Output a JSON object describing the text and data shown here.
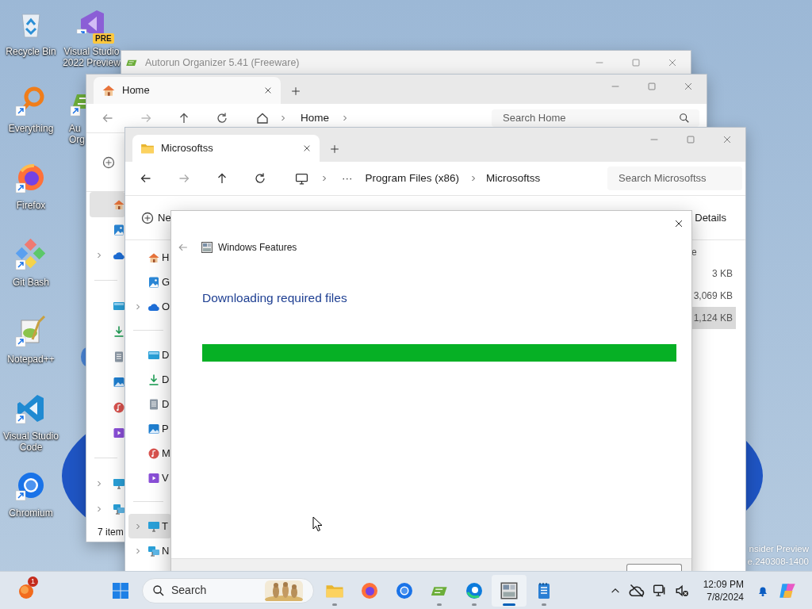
{
  "desktop": {
    "columns": [
      [
        {
          "label": "Recycle Bin",
          "shortcut": false
        },
        {
          "label": "Everything",
          "shortcut": true
        },
        {
          "label": "Firefox",
          "shortcut": true
        },
        {
          "label": "Git Bash",
          "shortcut": true
        },
        {
          "label": "Notepad++",
          "shortcut": true
        },
        {
          "label": "Visual Studio Code",
          "shortcut": true
        },
        {
          "label": "Chromium",
          "shortcut": true
        }
      ],
      [
        {
          "label": "Visual Studio 2022 Preview",
          "badge": "PRE",
          "shortcut": true
        },
        {
          "label": "Au Org",
          "shortcut": true
        }
      ]
    ]
  },
  "build_info": [
    "nsider Preview",
    "e.240308-1400"
  ],
  "autorun_window": {
    "title": "Autorun Organizer 5.41 (Freeware)"
  },
  "home_window": {
    "tab": "Home",
    "breadcrumb": "Home",
    "search": {
      "placeholder": "Search Home"
    },
    "nav_groups": [
      [
        {
          "selected": true,
          "expandable": false
        },
        {
          "selected": false,
          "expandable": false
        },
        {
          "selected": false,
          "expandable": true
        }
      ],
      [
        {
          "selected": false,
          "expandable": false
        },
        {
          "selected": false,
          "expandable": false
        },
        {
          "selected": false,
          "expandable": false
        },
        {
          "selected": false,
          "expandable": false
        },
        {
          "selected": false,
          "expandable": false
        },
        {
          "selected": false,
          "expandable": false
        }
      ],
      [
        {
          "selected": false,
          "expandable": true
        },
        {
          "selected": false,
          "expandable": true
        }
      ]
    ],
    "status": "7 item"
  },
  "folder_window": {
    "tab": "Microsoftss",
    "overflow": "···",
    "path": [
      "Program Files (x86)",
      "Microsoftss"
    ],
    "search": {
      "placeholder": "Search Microsoftss"
    },
    "new_button": "Ne",
    "view_button": "Details",
    "nav_groups": [
      [
        {
          "label": "H",
          "selected": false,
          "expandable": false
        },
        {
          "label": "G",
          "selected": false,
          "expandable": false
        },
        {
          "label": "O",
          "selected": false,
          "expandable": true
        }
      ],
      [
        {
          "label": "D",
          "selected": false,
          "expandable": false
        },
        {
          "label": "D",
          "selected": false,
          "expandable": false
        },
        {
          "label": "D",
          "selected": false,
          "expandable": false
        },
        {
          "label": "P",
          "selected": false,
          "expandable": false
        },
        {
          "label": "M",
          "selected": false,
          "expandable": false
        },
        {
          "label": "V",
          "selected": false,
          "expandable": false
        }
      ],
      [
        {
          "label": "T",
          "selected": true,
          "expandable": true
        },
        {
          "label": "N",
          "selected": false,
          "expandable": true
        }
      ]
    ],
    "size_header": "e",
    "file_sizes": [
      {
        "size": "3 KB",
        "selected": false
      },
      {
        "size": "3,069 KB",
        "selected": false
      },
      {
        "size": "1,124 KB",
        "selected": true
      }
    ]
  },
  "dialog": {
    "title": "Windows Features",
    "heading": "Downloading required files",
    "progress": {
      "level": 1
    }
  },
  "taskbar": {
    "widgets_badge": "1",
    "search": {
      "placeholder": "Search"
    },
    "apps": [
      {
        "running": true,
        "active": false
      },
      {
        "running": false,
        "active": false
      },
      {
        "running": false,
        "active": false
      },
      {
        "running": true,
        "active": false
      },
      {
        "running": true,
        "active": false
      },
      {
        "running": true,
        "active": true
      },
      {
        "running": true,
        "active": false
      }
    ],
    "time": "12:09 PM",
    "date": "7/8/2024"
  }
}
